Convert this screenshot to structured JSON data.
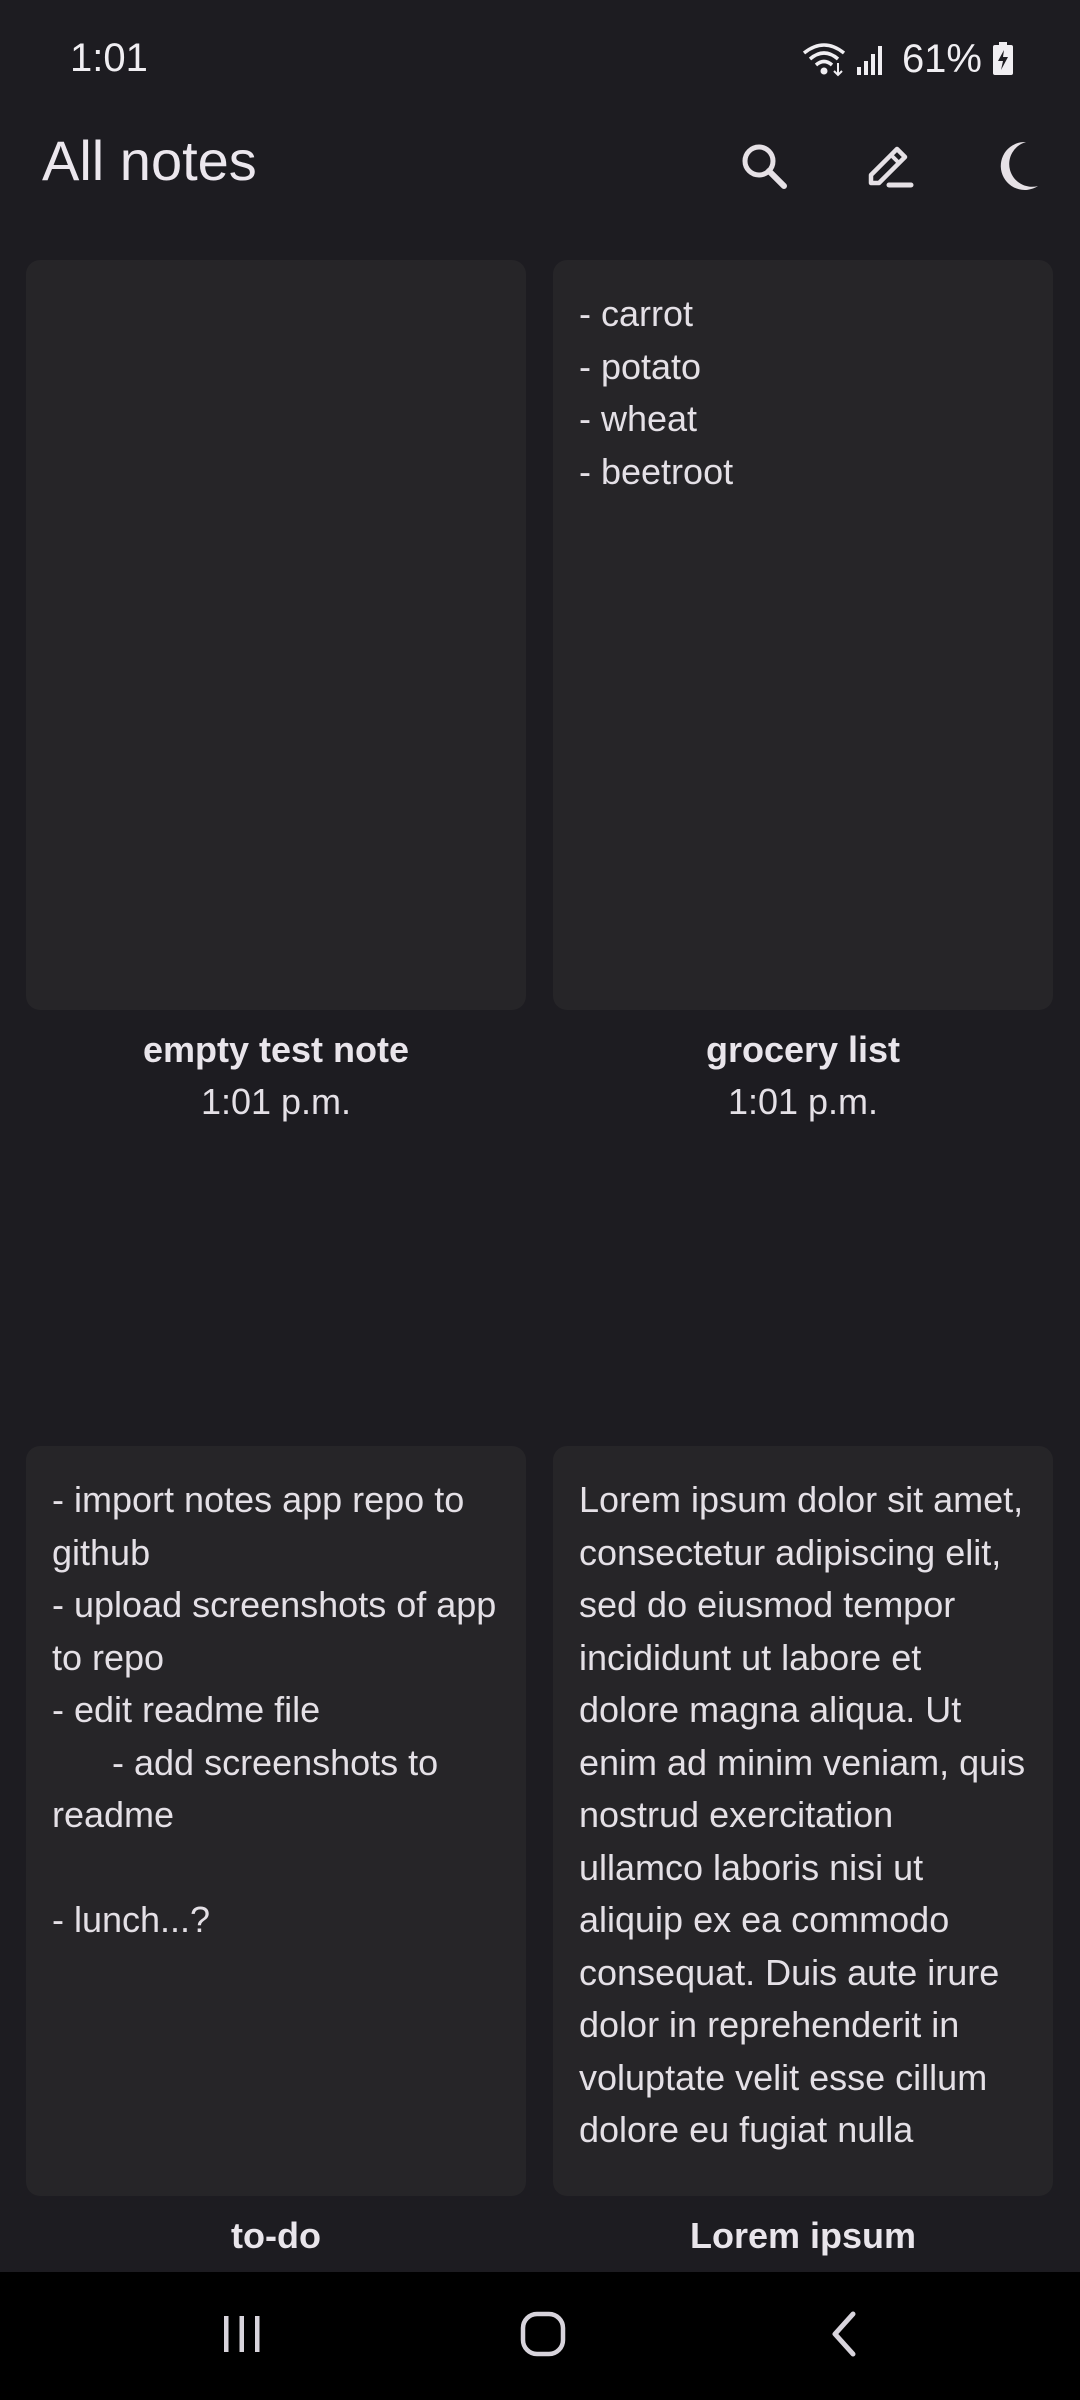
{
  "status_bar": {
    "time": "1:01",
    "battery": "61%"
  },
  "app_bar": {
    "title": "All notes",
    "icons": [
      "search-icon",
      "edit-icon",
      "dark-mode-icon"
    ]
  },
  "notes": [
    {
      "title": "empty test note",
      "time": "1:01 p.m.",
      "content": ""
    },
    {
      "title": "grocery list",
      "time": "1:01 p.m.",
      "content": "- carrot\n- potato\n- wheat\n- beetroot"
    },
    {
      "title": "to-do",
      "time": "",
      "content": "- import notes app repo to github\n- upload screenshots of app to repo\n- edit readme file\n      - add screenshots to readme\n\n- lunch...?"
    },
    {
      "title": "Lorem ipsum",
      "time": "",
      "content": "Lorem ipsum dolor sit amet, consectetur adipiscing elit, sed do eiusmod tempor incididunt ut labore et dolore magna aliqua. Ut enim ad minim veniam, quis nostrud exercitation ullamco laboris nisi ut aliquip ex ea commodo consequat. Duis aute irure dolor in reprehenderit in voluptate velit esse cillum dolore eu fugiat nulla"
    }
  ],
  "nav_bar": {
    "icons": [
      "recent-apps-icon",
      "home-icon",
      "back-icon"
    ]
  },
  "colors": {
    "background": "#1d1c21",
    "card": "#262528",
    "text": "#e4e0e6",
    "nav_bar": "#000000"
  }
}
